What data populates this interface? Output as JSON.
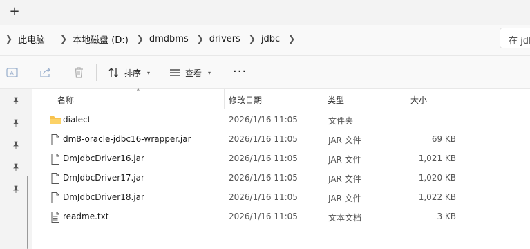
{
  "tabbar": {
    "new_tab": "+"
  },
  "breadcrumb": [
    "此电脑",
    "本地磁盘 (D:)",
    "dmdbms",
    "drivers",
    "jdbc"
  ],
  "search": {
    "placeholder": "在 jdbc 中搜索"
  },
  "toolbar": {
    "sort_label": "排序",
    "view_label": "查看",
    "more_label": "···"
  },
  "columns": {
    "name": "名称",
    "date": "修改日期",
    "type": "类型",
    "size": "大小"
  },
  "files": [
    {
      "name": "dialect",
      "date": "2026/1/16 11:05",
      "type": "文件夹",
      "size": "",
      "icon": "folder-icon"
    },
    {
      "name": "dm8-oracle-jdbc16-wrapper.jar",
      "date": "2026/1/16 11:05",
      "type": "JAR 文件",
      "size": "69 KB",
      "icon": "file-icon"
    },
    {
      "name": "DmJdbcDriver16.jar",
      "date": "2026/1/16 11:05",
      "type": "JAR 文件",
      "size": "1,021 KB",
      "icon": "file-icon"
    },
    {
      "name": "DmJdbcDriver17.jar",
      "date": "2026/1/16 11:05",
      "type": "JAR 文件",
      "size": "1,020 KB",
      "icon": "file-icon"
    },
    {
      "name": "DmJdbcDriver18.jar",
      "date": "2026/1/16 11:05",
      "type": "JAR 文件",
      "size": "1,022 KB",
      "icon": "file-icon"
    },
    {
      "name": "readme.txt",
      "date": "2026/1/16 11:05",
      "type": "文本文档",
      "size": "3 KB",
      "icon": "text-file-icon"
    }
  ],
  "colors": {
    "folder": "#f8c24e",
    "window_bg": "#f3f3f3",
    "content_bg": "#ffffff"
  }
}
